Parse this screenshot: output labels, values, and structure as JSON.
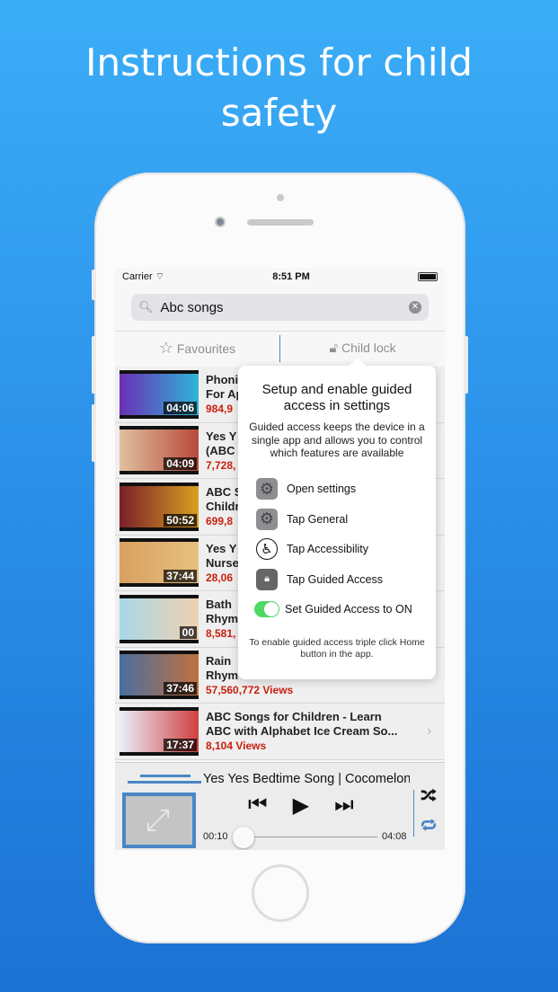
{
  "headline": "Instructions for child safety",
  "status": {
    "carrier": "Carrier",
    "time": "8:51 PM"
  },
  "search": {
    "value": "Abc songs"
  },
  "tabs": [
    {
      "label": "Favourites",
      "icon": "star-icon"
    },
    {
      "label": "Child lock",
      "icon": "lock-icon"
    }
  ],
  "videos": [
    {
      "line1": "Phoni",
      "line2": "For Ap",
      "views": "984,9",
      "duration": "04:06",
      "colors": [
        "#6b2fb5",
        "#2fb5d8"
      ]
    },
    {
      "line1": "Yes Y",
      "line2": "(ABC",
      "views": "7,728,",
      "duration": "04:09",
      "colors": [
        "#e0c0a0",
        "#b84a3a"
      ]
    },
    {
      "line1": "ABC S",
      "line2": "Childr",
      "views": "699,8",
      "duration": "50:52",
      "colors": [
        "#7a1f2a",
        "#d8a020"
      ]
    },
    {
      "line1": "Yes Y",
      "line2": "Nurse",
      "views": "28,06",
      "duration": "37:44",
      "colors": [
        "#d8a060",
        "#e8c080"
      ]
    },
    {
      "line1": "Bath",
      "line2": "Rhym",
      "views": "8,581,",
      "duration": "00",
      "colors": [
        "#a8d8e8",
        "#f0d0b0"
      ]
    },
    {
      "line1": "Rain",
      "line2": "Rhym",
      "views": "57,560,772 Views",
      "duration": "37:46",
      "colors": [
        "#4a6fa0",
        "#c07040"
      ]
    },
    {
      "line1": "ABC Songs for Children - Learn",
      "line2": "ABC with Alphabet Ice Cream So...",
      "views": "8,104 Views",
      "duration": "17:37",
      "colors": [
        "#e8f0f8",
        "#d04040"
      ]
    }
  ],
  "popover": {
    "title": "Setup and enable guided access in settings",
    "description": "Guided access keeps the device in a single app and allows you to control which features are available",
    "steps": [
      {
        "label": "Open settings",
        "icon": "settings-gear-icon"
      },
      {
        "label": "Tap General",
        "icon": "settings-gear-icon"
      },
      {
        "label": "Tap Accessibility",
        "icon": "accessibility-icon"
      },
      {
        "label": "Tap Guided Access",
        "icon": "guided-access-lock-icon"
      },
      {
        "label": "Set Guided Access to ON",
        "icon": "toggle-on-icon"
      }
    ],
    "footer": "To enable guided access triple click Home button in the app."
  },
  "player": {
    "title": "Yes Yes Bedtime Song | Cocomelon",
    "elapsed": "00:10",
    "duration": "04:08",
    "progress": 0.04
  },
  "colors": {
    "accent": "#4a87c5",
    "views": "#c8200e",
    "toggle": "#4cd964"
  }
}
